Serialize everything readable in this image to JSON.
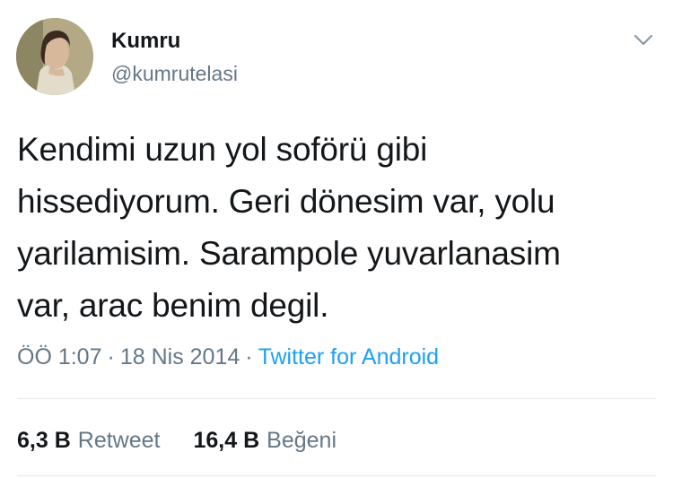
{
  "author": {
    "display_name": "Kumru",
    "handle": "@kumrutelasi"
  },
  "tweet": {
    "text": "Kendimi uzun yol soförü gibi\nhissediyorum. Geri dönesim var, yolu\nyarilamisim. Sarampole yuvarlanasim\nvar, arac benim degil.",
    "time": "ÖÖ 1:07",
    "separator": "·",
    "date": "18 Nis 2014",
    "source": "Twitter for Android"
  },
  "stats": {
    "retweets_count": "6,3 B",
    "retweets_label": "Retweet",
    "likes_count": "16,4 B",
    "likes_label": "Beğeni"
  },
  "icons": {
    "menu": "chevron-down-icon"
  },
  "colors": {
    "text": "#14171a",
    "secondary": "#657786",
    "link": "#1da1f2",
    "divider": "#e1e8ed"
  }
}
